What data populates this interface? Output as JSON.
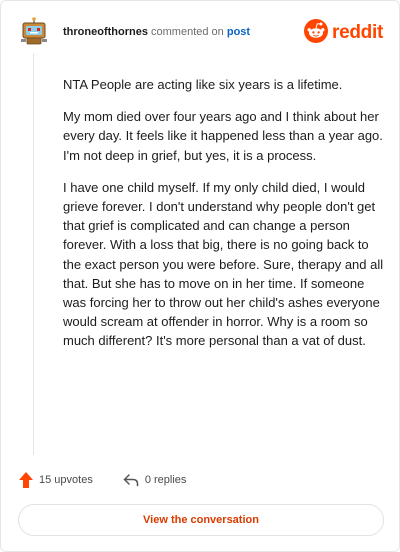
{
  "header": {
    "username": "throneofthornes",
    "action_text": "commented on",
    "post_link": "post",
    "brand": "reddit",
    "avatar_icon": "robot-avatar-icon",
    "brand_icon": "reddit-snoo-icon"
  },
  "comment": {
    "paragraphs": [
      "NTA People are acting like six years is a lifetime.",
      "My mom died over four years ago and I think about her every day. It feels like it happened less than a year ago. I'm not deep in grief, but yes, it is a process.",
      "I have one child myself. If my only child died, I would grieve forever. I don't understand why people don't get that grief is complicated and can change a person forever. With a loss that big, there is no going back to the exact person you were before. Sure, therapy and all that. But she has to move on in her time. If someone was forcing her to throw out her child's ashes everyone would scream at offender in horror. Why is a room so much different? It's more personal than a vat of dust."
    ]
  },
  "stats": {
    "upvotes": "15 upvotes",
    "replies": "0 replies",
    "upvote_icon": "upvote-arrow-icon",
    "reply_icon": "reply-arrow-icon"
  },
  "cta": {
    "label": "View the conversation"
  },
  "colors": {
    "accent": "#ff4500",
    "link": "#0a66c2",
    "cta_text": "#d93a00",
    "border": "#e6e6e6"
  }
}
